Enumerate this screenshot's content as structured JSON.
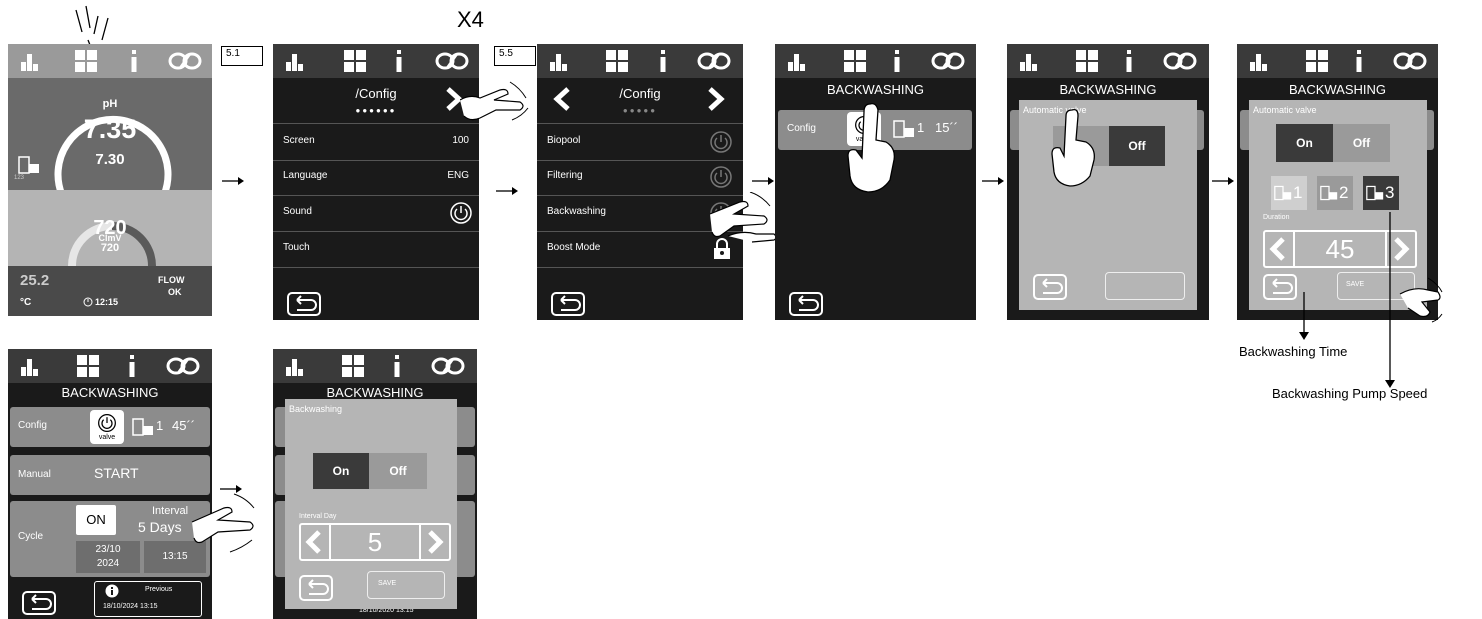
{
  "header_label": "X4",
  "step_labels": [
    "5.1",
    "5.5"
  ],
  "status_screen": {
    "ph_label": "pH",
    "ph_value": "7.35",
    "ph_setpoint": "7.30",
    "pump_code": "123",
    "clmv_label": "ClmV",
    "clmv_value": "720",
    "clmv_setpoint": "720",
    "temperature": "25.2",
    "temperature_unit": "°C",
    "time": "12:15",
    "flow_label": "FLOW",
    "flow_status": "OK"
  },
  "config_screen_1": {
    "title": "/Config",
    "page_dots": "●●●●●●",
    "rows": [
      {
        "label": "Screen",
        "value": "100"
      },
      {
        "label": "Language",
        "value": "ENG"
      },
      {
        "label": "Sound",
        "value": ""
      },
      {
        "label": "Touch",
        "value": ""
      }
    ]
  },
  "config_screen_5": {
    "title": "/Config",
    "page_dots": "●●●●●",
    "rows": [
      {
        "label": "Biopool"
      },
      {
        "label": "Filtering"
      },
      {
        "label": "Backwashing"
      },
      {
        "label": "Boost Mode"
      }
    ]
  },
  "backwash_screen": {
    "title": "BACKWASHING",
    "config_label": "Config",
    "valve_label": "valve",
    "pump_speed": "1",
    "duration": "15´´"
  },
  "valve_popup": {
    "title": "Automatic valve",
    "on_label": "O",
    "off_label": "Off"
  },
  "valve_popup_full": {
    "title": "Automatic valve",
    "on_label": "On",
    "off_label": "Off",
    "speeds": [
      "1",
      "2",
      "3"
    ],
    "duration_label": "Duration",
    "duration_value": "45",
    "save_label": "SAVE"
  },
  "annotations": {
    "backwashing_time": "Backwashing Time",
    "backwashing_pump_speed": "Backwashing Pump Speed"
  },
  "backwash_summary": {
    "title": "BACKWASHING",
    "config_label": "Config",
    "valve_label": "valve",
    "pump_speed": "1",
    "duration": "45´´",
    "manual_label": "Manual",
    "start_label": "START",
    "cycle_label": "Cycle",
    "cycle_state": "ON",
    "interval_label": "Interval",
    "interval_value": "5 Days",
    "date_line1": "23/10",
    "date_line2": "2024",
    "time": "13:15",
    "previous_label": "Previous",
    "previous_value": "18/10/2024 13:15"
  },
  "interval_popup": {
    "title": "BACKWASHING",
    "popup_title": "Backwashing",
    "on_label": "On",
    "off_label": "Off",
    "interval_label": "Interval Day",
    "interval_value": "5",
    "save_label": "SAVE",
    "footer_value": "18/10/2020 13:15"
  }
}
